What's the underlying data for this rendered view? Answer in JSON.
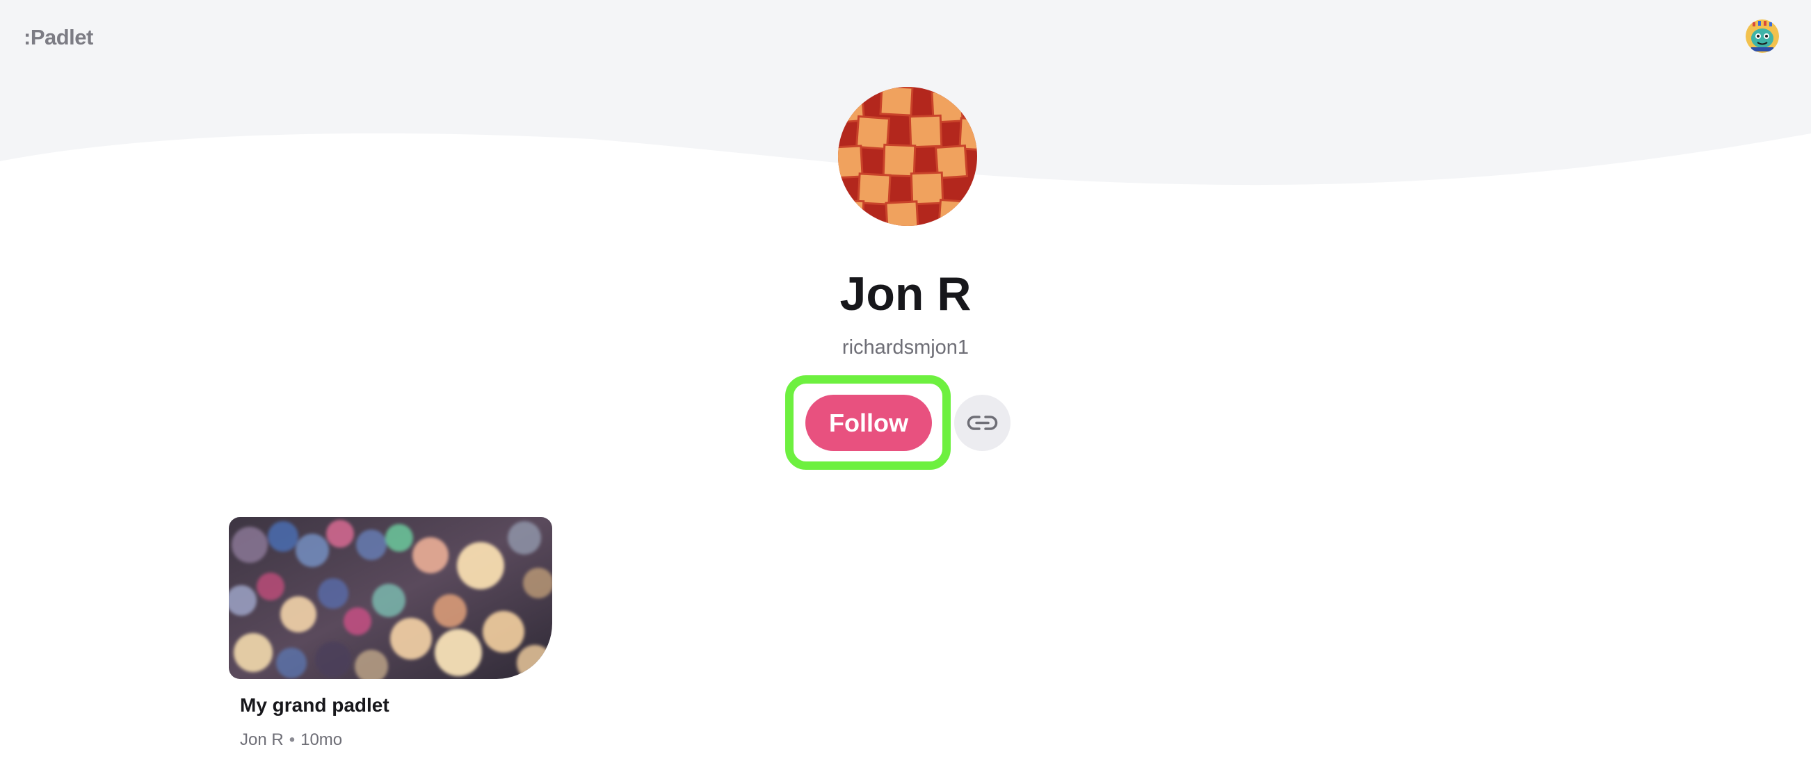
{
  "header": {
    "logo_text": ":Padlet",
    "background_color": "#f4f5f7",
    "user_avatar_icon": "monster-avatar-icon"
  },
  "profile": {
    "name": "Jon R",
    "username": "richardsmjon1",
    "avatar_icon": "checkerboard-avatar-icon",
    "follow_label": "Follow",
    "follow_color": "#e8517f",
    "highlight_color": "#6df03f",
    "copy_link_icon": "link-icon"
  },
  "padlets": [
    {
      "title": "My grand padlet",
      "author": "Jon R",
      "separator": "•",
      "age": "10mo",
      "thumbnail_icon": "bokeh-lights-thumbnail"
    }
  ]
}
